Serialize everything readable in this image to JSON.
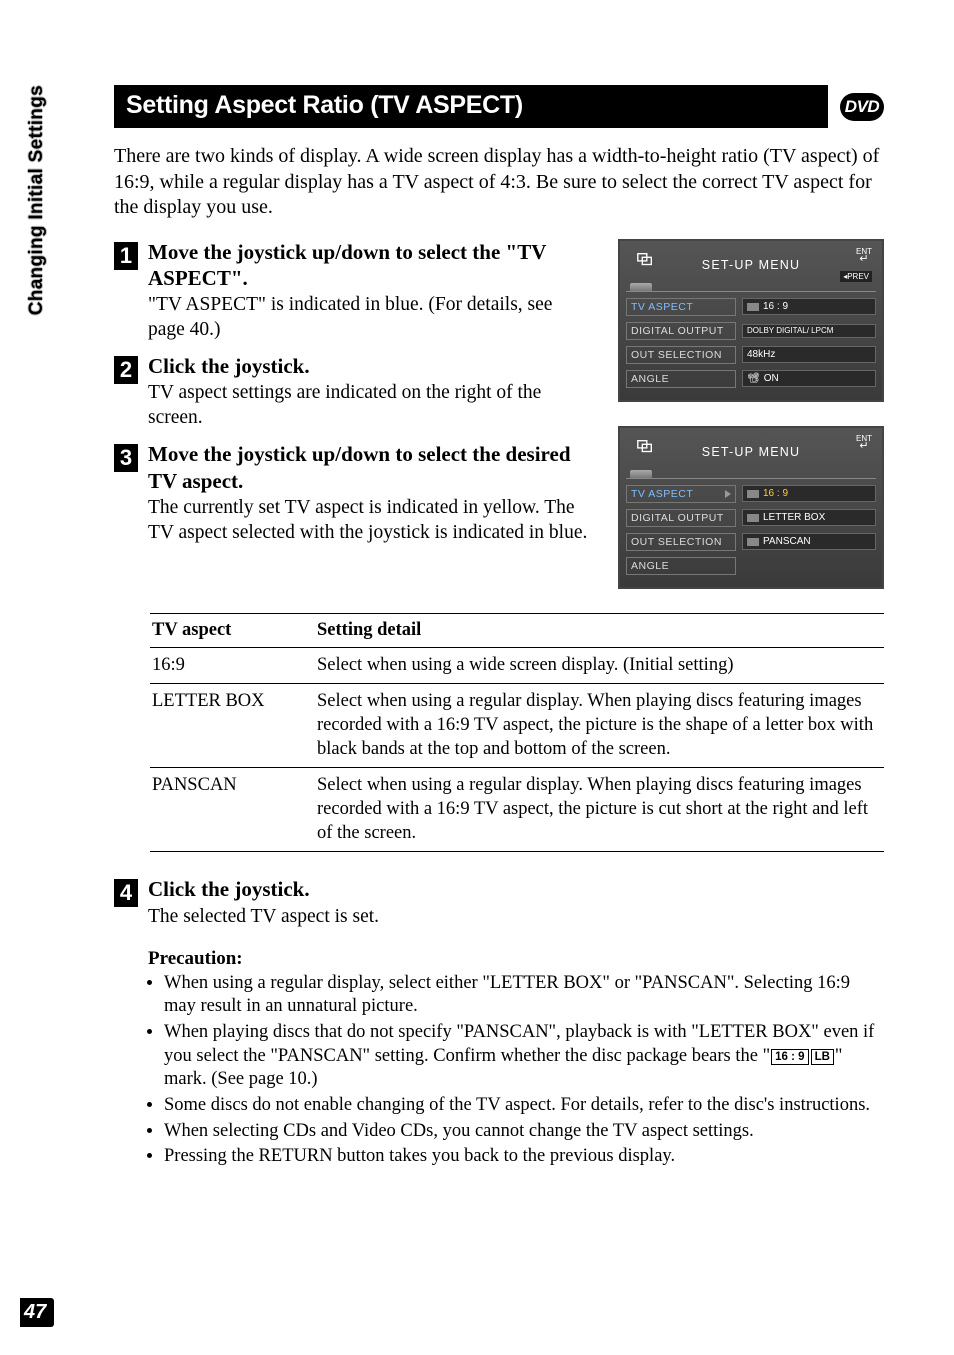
{
  "sidebar_label": "Changing Initial Settings",
  "page_number": "47",
  "header": {
    "title": "Setting Aspect Ratio (TV ASPECT)",
    "badge": "DVD"
  },
  "intro": "There are two kinds of display. A wide screen display has a width-to-height ratio (TV aspect) of 16:9, while a regular display has a TV aspect of 4:3. Be sure to select the correct TV aspect for the display you use.",
  "steps": {
    "s1": {
      "num": "1",
      "title": "Move the joystick up/down to select the \"TV ASPECT\".",
      "desc": "\"TV ASPECT\" is indicated in blue. (For details, see page 40.)"
    },
    "s2": {
      "num": "2",
      "title": "Click the joystick.",
      "desc": "TV aspect settings are indicated on the right of the screen."
    },
    "s3": {
      "num": "3",
      "title": "Move the joystick up/down to select the desired TV aspect.",
      "desc": "The currently set TV aspect is indicated in yellow. The TV aspect selected with the joystick is indicated in blue."
    },
    "s4": {
      "num": "4",
      "title": "Click the joystick.",
      "desc": "The selected TV aspect is set."
    }
  },
  "screenshot1": {
    "title": "SET-UP MENU",
    "ent": "ENT",
    "prev": "◂PREV",
    "rows": [
      {
        "label": "TV ASPECT",
        "val": "16 : 9",
        "active": true
      },
      {
        "label": "DIGITAL OUTPUT",
        "val": "DOLBY DIGITAL/\nLPCM"
      },
      {
        "label": "OUT SELECTION",
        "val": "48kHz"
      },
      {
        "label": "ANGLE",
        "val": "ON"
      }
    ]
  },
  "screenshot2": {
    "title": "SET-UP MENU",
    "ent": "ENT",
    "rows": [
      {
        "label": "TV ASPECT",
        "val": "16 : 9",
        "active": true,
        "sel": true
      },
      {
        "label": "DIGITAL OUTPUT",
        "val": "LETTER BOX"
      },
      {
        "label": "OUT SELECTION",
        "val": "PANSCAN"
      },
      {
        "label": "ANGLE",
        "val": ""
      }
    ]
  },
  "table": {
    "h1": "TV aspect",
    "h2": "Setting detail",
    "rows": [
      {
        "c1": "16:9",
        "c2": "Select when using a wide screen display. (Initial setting)"
      },
      {
        "c1": "LETTER BOX",
        "c2": "Select when using a regular display. When playing discs featuring images recorded with a 16:9 TV aspect, the picture is the shape of a letter box with black bands at the top and bottom of the screen."
      },
      {
        "c1": "PANSCAN",
        "c2": "Select when using a regular display. When playing discs featuring images recorded with a 16:9 TV aspect, the picture is cut short at the right and left of the screen."
      }
    ]
  },
  "precaution": {
    "title": "Precaution:",
    "items": {
      "p1": "When using a regular display, select either \"LETTER BOX\" or \"PANSCAN\". Selecting 16:9 may result in an unnatural picture.",
      "p2a": "When playing discs that do not specify \"PANSCAN\", playback is with \"LETTER BOX\" even if you select the \"PANSCAN\" setting. Confirm whether the disc package bears the \"",
      "p2_mark1": "16 : 9",
      "p2_mark2": "LB",
      "p2b": "\" mark. (See page 10.)",
      "p3": "Some discs do not enable changing of the TV aspect. For details, refer to the disc's instructions.",
      "p4": "When selecting CDs and Video CDs, you cannot change the TV aspect settings.",
      "p5": "Pressing the RETURN button takes you back to the previous display."
    }
  }
}
